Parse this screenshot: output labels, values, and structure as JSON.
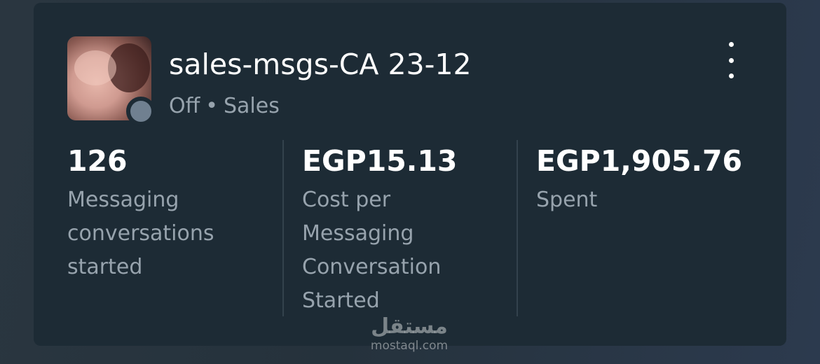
{
  "campaign": {
    "title": "sales-msgs-CA 23-12",
    "status": "Off",
    "separator": "•",
    "category": "Sales",
    "status_color": "#708090"
  },
  "menu": {
    "icon": "more-vertical-icon"
  },
  "metrics": [
    {
      "value": "126",
      "label": "Messaging conversations started"
    },
    {
      "value": "EGP15.13",
      "label": "Cost per Messaging Conversation Started"
    },
    {
      "value": "EGP1,905.76",
      "label": "Spent"
    }
  ],
  "watermark": {
    "logo_text": "مستقل",
    "site": "mostaql.com"
  }
}
